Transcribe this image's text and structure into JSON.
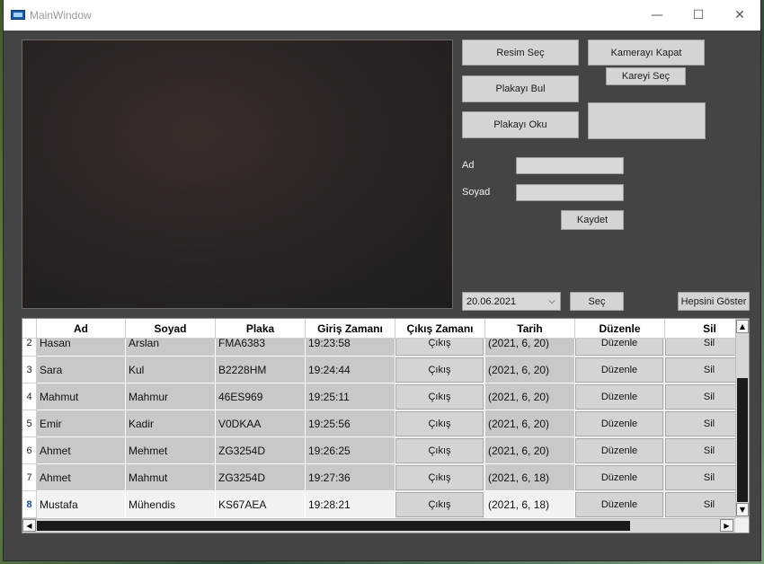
{
  "window": {
    "title": "MainWindow",
    "minimize_glyph": "—",
    "maximize_glyph": "☐",
    "close_glyph": "✕"
  },
  "buttons": {
    "resim_sec": "Resim Seç",
    "kamerayi_kapat": "Kamerayı Kapat",
    "kareyi_sec": "Kareyi Seç",
    "plakayi_bul": "Plakayı Bul",
    "plakayi_oku": "Plakayı Oku",
    "kaydet": "Kaydet",
    "sec": "Seç",
    "hepsini_goster": "Hepsini Göster"
  },
  "form": {
    "ad_label": "Ad",
    "soyad_label": "Soyad",
    "ad_value": "",
    "soyad_value": ""
  },
  "date_picker": {
    "value": "20.06.2021",
    "arrow": "⌵"
  },
  "table": {
    "columns": [
      "Ad",
      "Soyad",
      "Plaka",
      "Giriş Zamanı",
      "Çıkış Zamanı",
      "Tarih",
      "Düzenle",
      "Sil"
    ],
    "rows": [
      {
        "num": "2",
        "ad": "Hasan",
        "soyad": "Arslan",
        "plaka": "FMA6383",
        "giris": "19:23:58",
        "cikis": "Çıkış",
        "tarih": "(2021, 6, 20)",
        "duzenle": "Düzenle",
        "sil": "Sil"
      },
      {
        "num": "3",
        "ad": "Sara",
        "soyad": "Kul",
        "plaka": "B2228HM",
        "giris": "19:24:44",
        "cikis": "Çıkış",
        "tarih": "(2021, 6, 20)",
        "duzenle": "Düzenle",
        "sil": "Sil"
      },
      {
        "num": "4",
        "ad": "Mahmut",
        "soyad": "Mahmur",
        "plaka": "46ES969",
        "giris": "19:25:11",
        "cikis": "Çıkış",
        "tarih": "(2021, 6, 20)",
        "duzenle": "Düzenle",
        "sil": "Sil"
      },
      {
        "num": "5",
        "ad": "Emir",
        "soyad": "Kadir",
        "plaka": "V0DKAA",
        "giris": "19:25:56",
        "cikis": "Çıkış",
        "tarih": "(2021, 6, 20)",
        "duzenle": "Düzenle",
        "sil": "Sil"
      },
      {
        "num": "6",
        "ad": "Ahmet",
        "soyad": "Mehmet",
        "plaka": "ZG3254D",
        "giris": "19:26:25",
        "cikis": "Çıkış",
        "tarih": "(2021, 6, 20)",
        "duzenle": "Düzenle",
        "sil": "Sil"
      },
      {
        "num": "7",
        "ad": "Ahmet",
        "soyad": "Mahmut",
        "plaka": "ZG3254D",
        "giris": "19:27:36",
        "cikis": "Çıkış",
        "tarih": "(2021, 6, 18)",
        "duzenle": "Düzenle",
        "sil": "Sil"
      },
      {
        "num": "8",
        "ad": "Mustafa",
        "soyad": "Mühendis",
        "plaka": "KS67AEA",
        "giris": "19:28:21",
        "cikis": "Çıkış",
        "tarih": "(2021, 6, 18)",
        "duzenle": "Düzenle",
        "sil": "Sil"
      }
    ],
    "selected_row": "8",
    "scroll_up": "▲",
    "scroll_down": "▼",
    "scroll_left": "◀",
    "scroll_right": "▶"
  },
  "colors": {
    "window_bg": "#444444",
    "button_bg": "#d4d4d4",
    "cell_bg": "#c8c8c8"
  }
}
